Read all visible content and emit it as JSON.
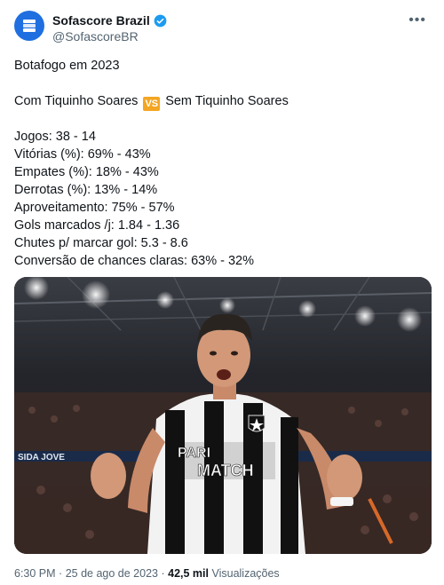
{
  "author": {
    "display_name": "Sofascore Brazil",
    "handle": "@SofascoreBR",
    "verified_badge_color": "#1d9bf0",
    "avatar_color": "#1f6fe0"
  },
  "more_icon": "more-dots-icon",
  "tweet": {
    "title": "Botafogo em 2023",
    "vs_line": {
      "left": "Com Tiquinho Soares",
      "badge": "VS",
      "right": "Sem Tiquinho Soares"
    },
    "stats": [
      "Jogos: 38 - 14",
      "Vitórias (%): 69% - 43%",
      "Empates (%): 18% - 43%",
      "Derrotas (%): 13% - 14%",
      "Aproveitamento: 75% - 57%",
      "Gols marcados /j: 1.84 - 1.36",
      "Chutes p/ marcar gol: 5.3 - 8.6",
      "Conversão de chances claras: 63% - 32%"
    ]
  },
  "photo": {
    "jersey_sponsor_line1": "PARI",
    "jersey_sponsor_line2": "MATCH",
    "ad_board_text": "SIDA JOVE"
  },
  "meta": {
    "time": "6:30 PM",
    "separator": "·",
    "date": "25 de ago de 2023",
    "views": "42,5 mil",
    "views_label": "Visualizações"
  }
}
